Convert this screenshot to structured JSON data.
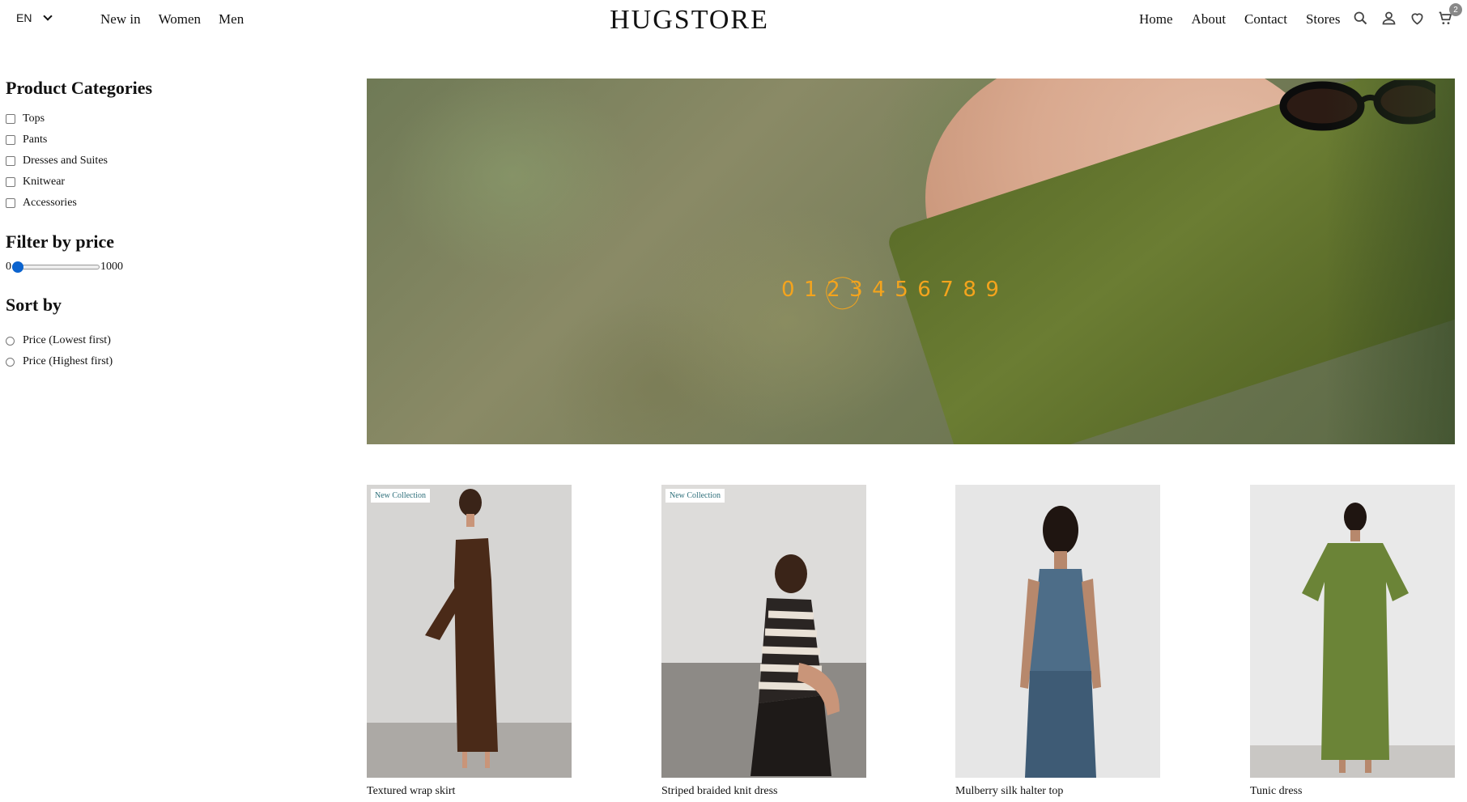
{
  "header": {
    "language": "EN",
    "left_nav": [
      "New in",
      "Women",
      "Men"
    ],
    "brand": "HUGSTORE",
    "right_nav": [
      "Home",
      "About",
      "Contact",
      "Stores"
    ],
    "cart_count": "2",
    "icons": [
      "search-icon",
      "user-icon",
      "heart-icon",
      "cart-icon"
    ]
  },
  "sidebar": {
    "categories_title": "Product Categories",
    "categories": [
      "Tops",
      "Pants",
      "Dresses and Suites",
      "Knitwear",
      "Accessories"
    ],
    "price_title": "Filter by price",
    "price_min": "0",
    "price_max": "1000",
    "price_value": 0,
    "sort_title": "Sort by",
    "sort_options": [
      "Price (Lowest first)",
      "Price (Highest first)"
    ]
  },
  "hero": {
    "digits": "0123456789",
    "circled_digit": "2",
    "accent_color": "#f4a41d"
  },
  "products": [
    {
      "name": "Textured wrap skirt",
      "badge": "New Collection",
      "garment_color": "#4a2a18"
    },
    {
      "name": "Striped braided knit dress",
      "badge": "New Collection",
      "garment_color": "#2a2523"
    },
    {
      "name": "Mulberry silk halter top",
      "badge": "",
      "garment_color": "#4d6d88"
    },
    {
      "name": "Tunic dress",
      "badge": "",
      "garment_color": "#6b8437"
    }
  ]
}
